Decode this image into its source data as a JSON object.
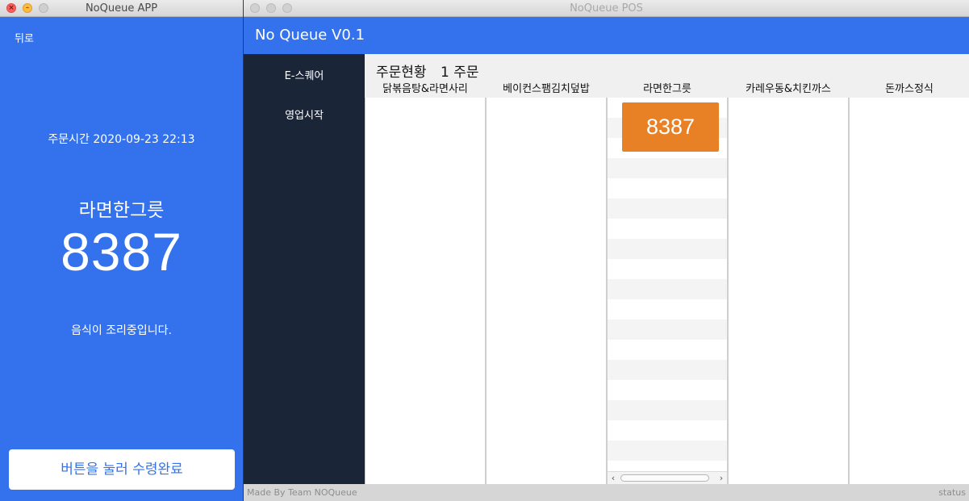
{
  "app_window": {
    "title": "NoQueue APP",
    "back_label": "뒤로",
    "order_time": "주문시간 2020-09-23 22:13",
    "menu_name": "라면한그릇",
    "order_number": "8387",
    "status_message": "음식이 조리중입니다.",
    "receive_button_label": "버튼을 눌러 수령완료"
  },
  "pos_window": {
    "title": "NoQueue POS",
    "header_title": "No Queue V0.1",
    "sidebar": {
      "items": [
        {
          "label": "E-스퀘어"
        },
        {
          "label": "영업시작"
        }
      ]
    },
    "main": {
      "title_label": "주문현황",
      "order_count": "1 주문",
      "columns": [
        {
          "header": "닭볶음탕&라면사리"
        },
        {
          "header": "베이컨스팸김치덮밥"
        },
        {
          "header": "라면한그릇",
          "orders": [
            "8387"
          ]
        },
        {
          "header": "카레우동&치킨까스"
        },
        {
          "header": "돈까스정식"
        }
      ]
    },
    "footer": {
      "left_text": "Made By Team NOQueue",
      "right_text": "status"
    }
  },
  "colors": {
    "brand_blue": "#3472ed",
    "sidebar_dark": "#1a2538",
    "order_card_orange": "#e88025"
  }
}
